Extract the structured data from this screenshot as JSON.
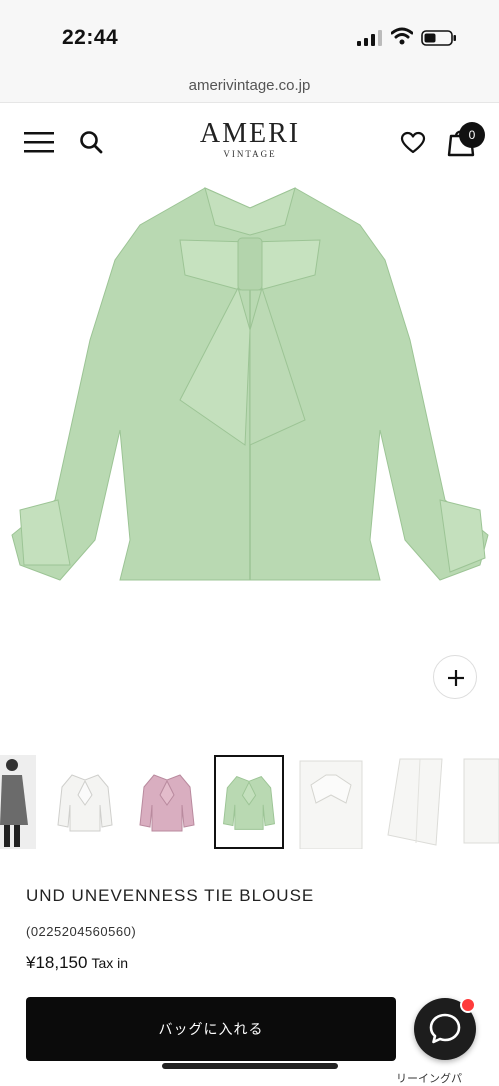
{
  "status_bar": {
    "time": "22:44"
  },
  "browser": {
    "url": "amerivintage.co.jp"
  },
  "header": {
    "logo_main": "AMERI",
    "logo_sub": "VINTAGE",
    "bag_count": "0"
  },
  "gallery": {
    "thumbnail_count": 7,
    "active_index": 3,
    "main_color": "#b9d9b2",
    "thumbnail_colors": [
      "#6b6b6b",
      "#f4f4f2",
      "#d9aec0",
      "#b9d9b2",
      "#f4f4f2",
      "#f6f6f4",
      "#f6f6f4"
    ]
  },
  "product": {
    "title": "UND UNEVENNESS TIE BLOUSE",
    "code": "(0225204560560)",
    "price": "¥18,150",
    "tax_label": "Tax in"
  },
  "actions": {
    "add_to_bag_label": "バッグに入れる"
  },
  "footer": {
    "cut_text": "リーイングパ"
  }
}
